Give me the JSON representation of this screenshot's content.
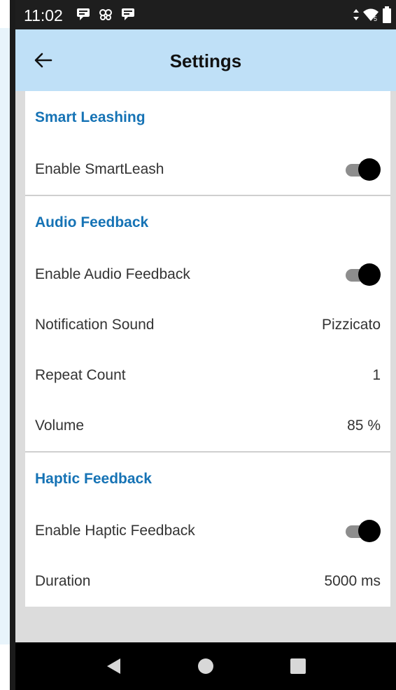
{
  "status_bar": {
    "time": "11:02",
    "notification_icons": [
      "messenger-icon",
      "cloud-icon",
      "messenger-icon"
    ],
    "right_icons": [
      "data-arrows-icon",
      "wifi-icon",
      "battery-icon"
    ]
  },
  "app_bar": {
    "title": "Settings",
    "back_icon": "back-arrow-icon"
  },
  "sections": {
    "smart_leashing": {
      "header": "Smart Leashing",
      "enable_label": "Enable SmartLeash",
      "enable_on": true
    },
    "audio_feedback": {
      "header": "Audio Feedback",
      "enable_label": "Enable Audio Feedback",
      "enable_on": true,
      "notification_sound_label": "Notification Sound",
      "notification_sound_value": "Pizzicato",
      "repeat_count_label": "Repeat Count",
      "repeat_count_value": "1",
      "volume_label": "Volume",
      "volume_value": "85 %"
    },
    "haptic_feedback": {
      "header": "Haptic Feedback",
      "enable_label": "Enable Haptic Feedback",
      "enable_on": true,
      "duration_label": "Duration",
      "duration_value": "5000 ms"
    }
  },
  "colors": {
    "app_bar": "#bfe0f7",
    "section_header": "#1673b5",
    "toggle_thumb": "#000000",
    "toggle_track": "#8d8d8d"
  },
  "nav_bar": {
    "buttons": [
      "back-triangle-icon",
      "home-circle-icon",
      "recents-square-icon"
    ]
  }
}
